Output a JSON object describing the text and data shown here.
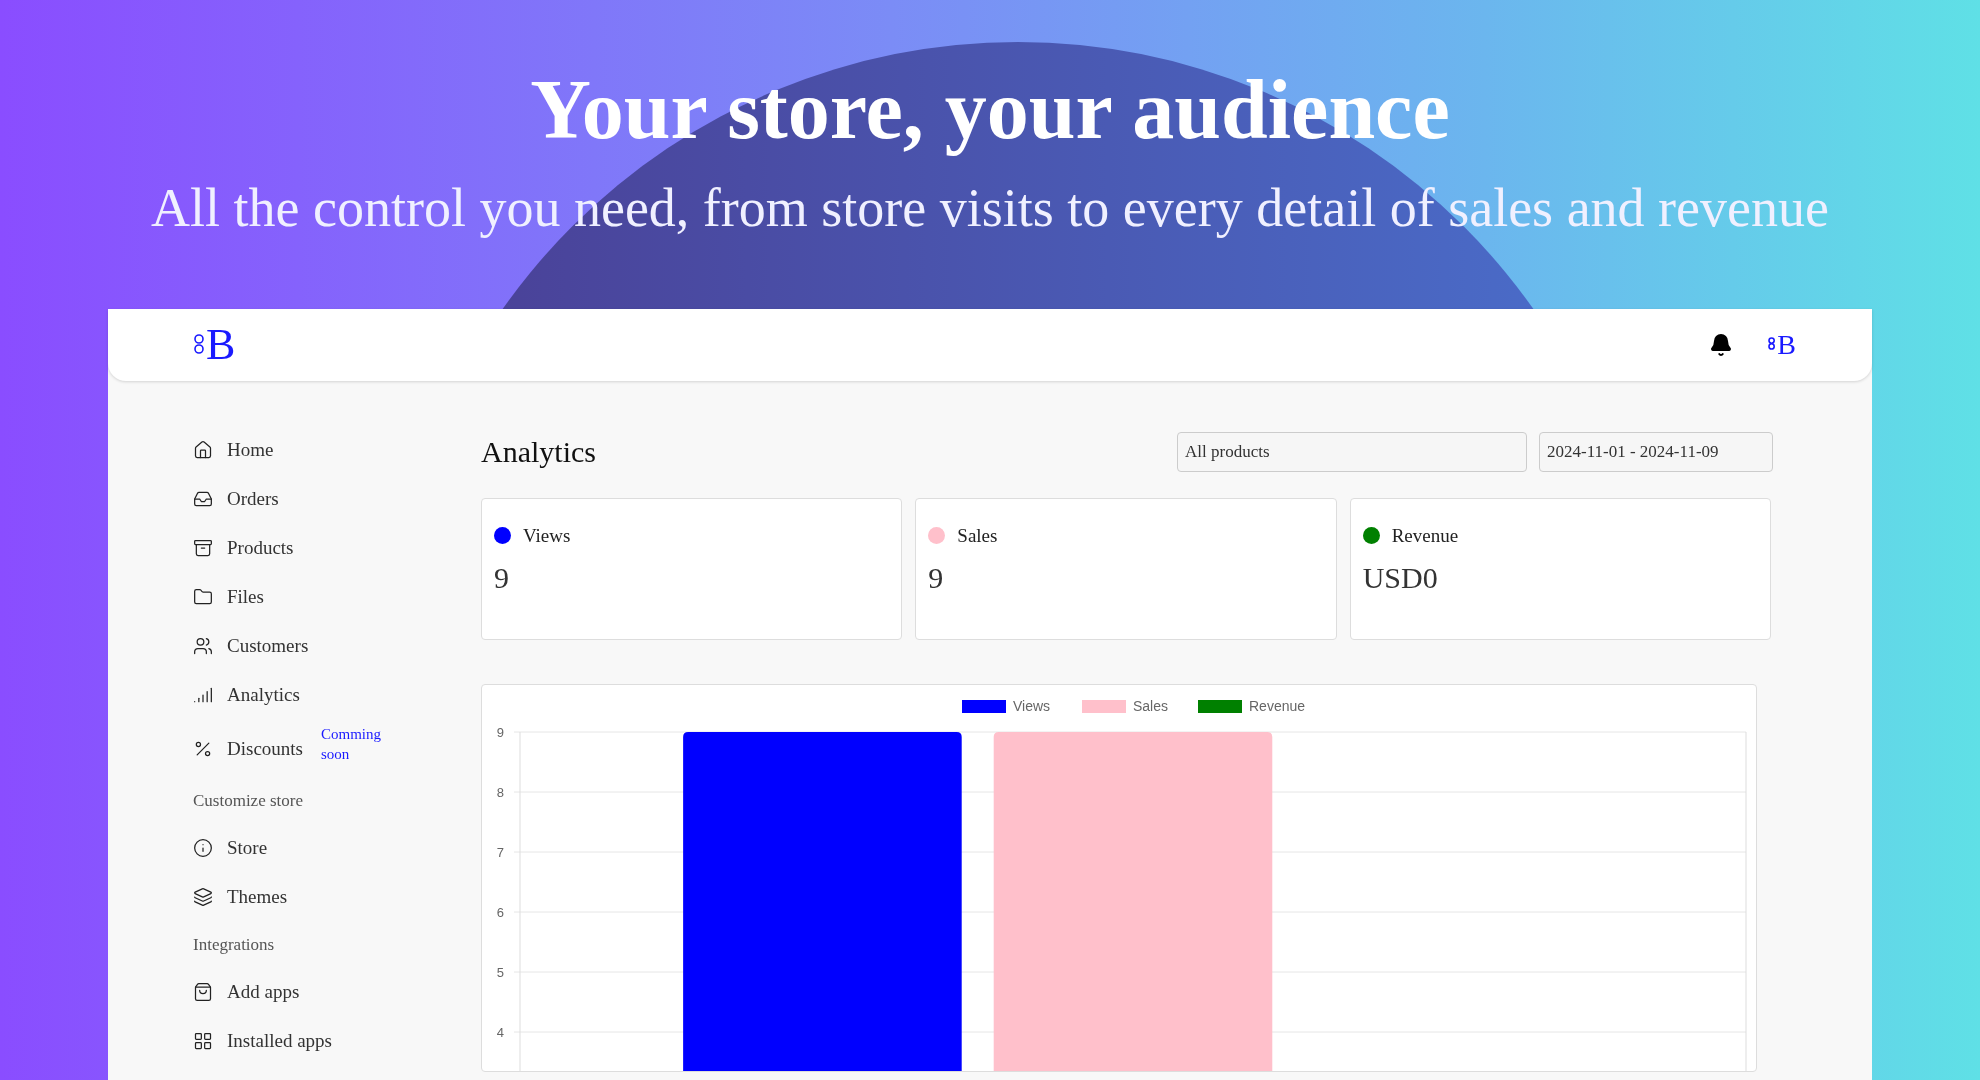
{
  "hero": {
    "title": "Your store, your audience",
    "subtitle": "All the control you need, from store visits to every detail of sales and revenue"
  },
  "header": {
    "logo": "B",
    "avatar": "B"
  },
  "sidebar": {
    "items": [
      {
        "kind": "link",
        "label": "Home"
      },
      {
        "kind": "link",
        "label": "Orders"
      },
      {
        "kind": "link",
        "label": "Products"
      },
      {
        "kind": "link",
        "label": "Files"
      },
      {
        "kind": "link",
        "label": "Customers"
      },
      {
        "kind": "link",
        "label": "Analytics"
      },
      {
        "kind": "link",
        "label": "Discounts",
        "badge": "Comming soon"
      },
      {
        "kind": "heading",
        "label": "Customize store"
      },
      {
        "kind": "link",
        "label": "Store"
      },
      {
        "kind": "link",
        "label": "Themes"
      },
      {
        "kind": "heading",
        "label": "Integrations"
      },
      {
        "kind": "link",
        "label": "Add apps"
      },
      {
        "kind": "link",
        "label": "Installed apps"
      }
    ]
  },
  "main": {
    "title": "Analytics",
    "product_filter": {
      "value": "All products"
    },
    "date_range": {
      "value": "2024-11-01 - 2024-11-09"
    },
    "stats": [
      {
        "label": "Views",
        "value": "9",
        "color": "#0000ff"
      },
      {
        "label": "Sales",
        "value": "9",
        "color": "#ffc0cb"
      },
      {
        "label": "Revenue",
        "value": "USD0",
        "color": "#008000"
      }
    ],
    "chart": {
      "chart_data": {
        "type": "bar",
        "ylim": [
          3.35,
          9
        ],
        "yticks": [
          4,
          5,
          6,
          7,
          8,
          9
        ],
        "grid": true,
        "legend": true,
        "series": [
          {
            "name": "Views",
            "color": "#0000ff",
            "values": [
              9
            ]
          },
          {
            "name": "Sales",
            "color": "#ffc0cb",
            "values": [
              9
            ]
          },
          {
            "name": "Revenue",
            "color": "#008000",
            "values": [
              null
            ]
          }
        ]
      }
    }
  }
}
